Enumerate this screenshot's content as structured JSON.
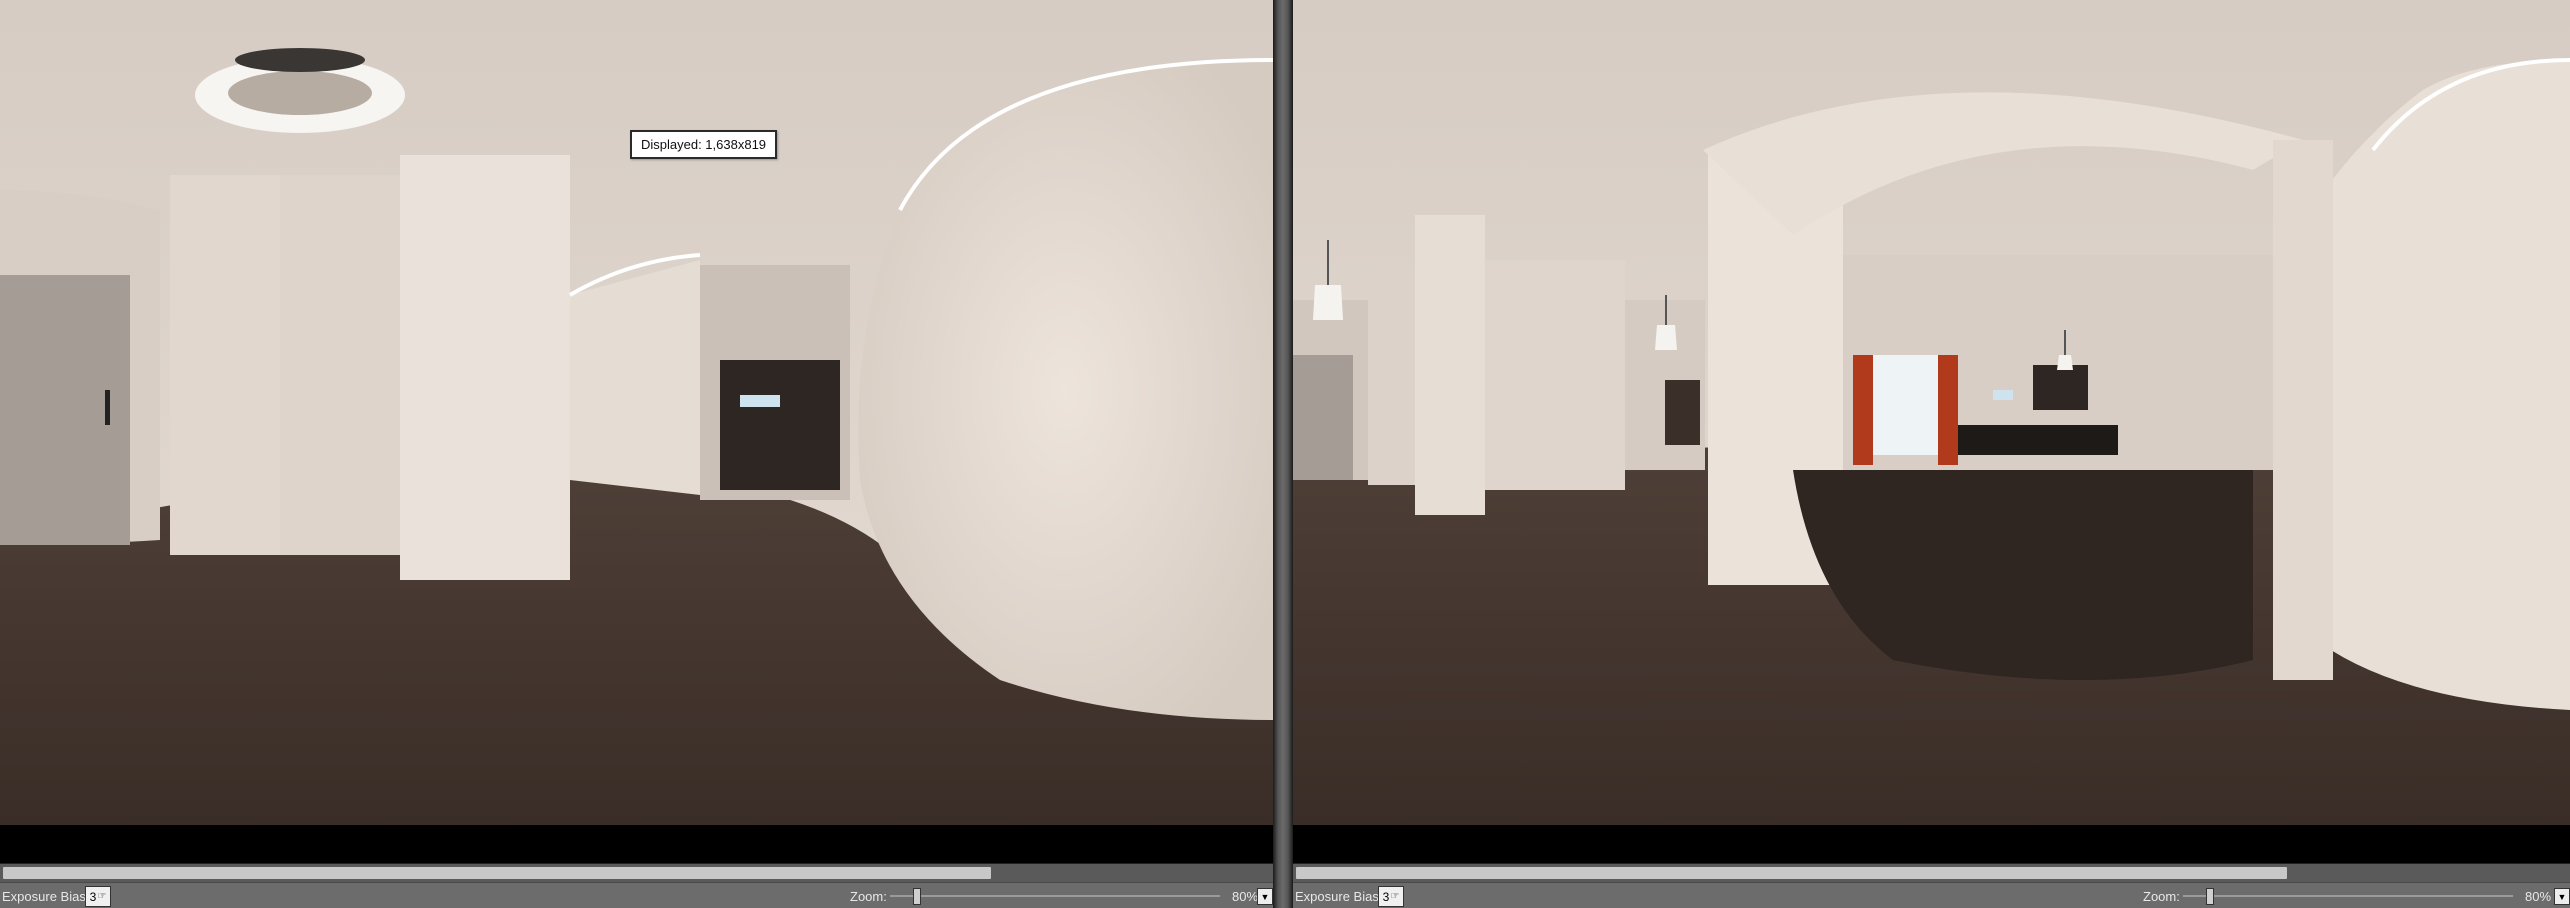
{
  "tooltip": {
    "text": "Displayed: 1,638x819"
  },
  "left_panel": {
    "exposure_label": "Exposure Bias:",
    "exposure_value": "3",
    "zoom_label": "Zoom:",
    "zoom_value": "80%",
    "zoom_level": 0.08,
    "hscroll_fraction": 0.78
  },
  "right_panel": {
    "exposure_label": "Exposure Bias:",
    "exposure_value": "3",
    "zoom_label": "Zoom:",
    "zoom_value": "80%",
    "zoom_level": 0.08,
    "hscroll_fraction": 0.78
  },
  "icons": {
    "exposure": "cursor-hand-icon",
    "dropdown": "chevron-down-icon"
  },
  "colors": {
    "wall": "#e3d8cf",
    "ceiling": "#d8cfc7",
    "floor": "#4a3b33",
    "curtain": "#b23a1c",
    "statusbar": "#6c6c6c"
  }
}
